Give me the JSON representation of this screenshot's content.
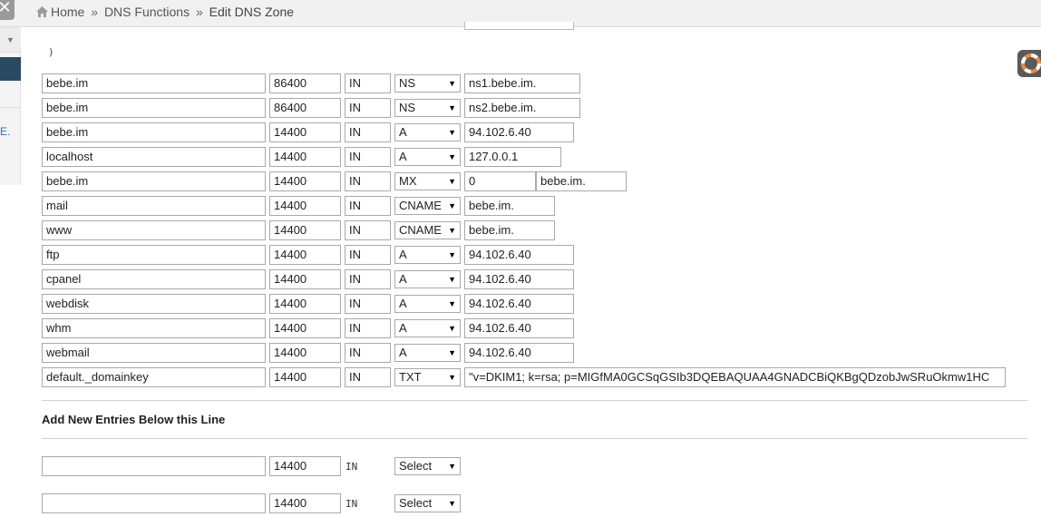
{
  "breadcrumb": {
    "home": "Home",
    "sep": "»",
    "section": "DNS Functions",
    "current": "Edit DNS Zone"
  },
  "header": {
    "close_glyph": "✕"
  },
  "sidebar": {
    "chevron": "▼",
    "link_text": "E."
  },
  "zone": {
    "paren": ")",
    "records": [
      {
        "name": "bebe.im",
        "ttl": "86400",
        "class": "IN",
        "type": "NS",
        "values": [
          "ns1.bebe.im."
        ]
      },
      {
        "name": "bebe.im",
        "ttl": "86400",
        "class": "IN",
        "type": "NS",
        "values": [
          "ns2.bebe.im."
        ]
      },
      {
        "name": "bebe.im",
        "ttl": "14400",
        "class": "IN",
        "type": "A",
        "values": [
          "94.102.6.40"
        ]
      },
      {
        "name": "localhost",
        "ttl": "14400",
        "class": "IN",
        "type": "A",
        "values": [
          "127.0.0.1"
        ]
      },
      {
        "name": "bebe.im",
        "ttl": "14400",
        "class": "IN",
        "type": "MX",
        "values": [
          "0",
          "bebe.im."
        ]
      },
      {
        "name": "mail",
        "ttl": "14400",
        "class": "IN",
        "type": "CNAME",
        "values": [
          "bebe.im."
        ]
      },
      {
        "name": "www",
        "ttl": "14400",
        "class": "IN",
        "type": "CNAME",
        "values": [
          "bebe.im."
        ]
      },
      {
        "name": "ftp",
        "ttl": "14400",
        "class": "IN",
        "type": "A",
        "values": [
          "94.102.6.40"
        ]
      },
      {
        "name": "cpanel",
        "ttl": "14400",
        "class": "IN",
        "type": "A",
        "values": [
          "94.102.6.40"
        ]
      },
      {
        "name": "webdisk",
        "ttl": "14400",
        "class": "IN",
        "type": "A",
        "values": [
          "94.102.6.40"
        ]
      },
      {
        "name": "whm",
        "ttl": "14400",
        "class": "IN",
        "type": "A",
        "values": [
          "94.102.6.40"
        ]
      },
      {
        "name": "webmail",
        "ttl": "14400",
        "class": "IN",
        "type": "A",
        "values": [
          "94.102.6.40"
        ]
      },
      {
        "name": "default._domainkey",
        "ttl": "14400",
        "class": "IN",
        "type": "TXT",
        "values": [
          "\"v=DKIM1; k=rsa; p=MIGfMA0GCSqGSIb3DQEBAQUAA4GNADCBiQKBgQDzobJwSRuOkmw1HC"
        ]
      }
    ]
  },
  "new_entries": {
    "title": "Add New Entries Below this Line",
    "rows": [
      {
        "name": "",
        "ttl": "14400",
        "class": "IN",
        "type": "Select"
      },
      {
        "name": "",
        "ttl": "14400",
        "class": "IN",
        "type": "Select"
      }
    ]
  },
  "colors": {
    "sidebar_active": "#294a63",
    "link": "#2a6fba"
  }
}
